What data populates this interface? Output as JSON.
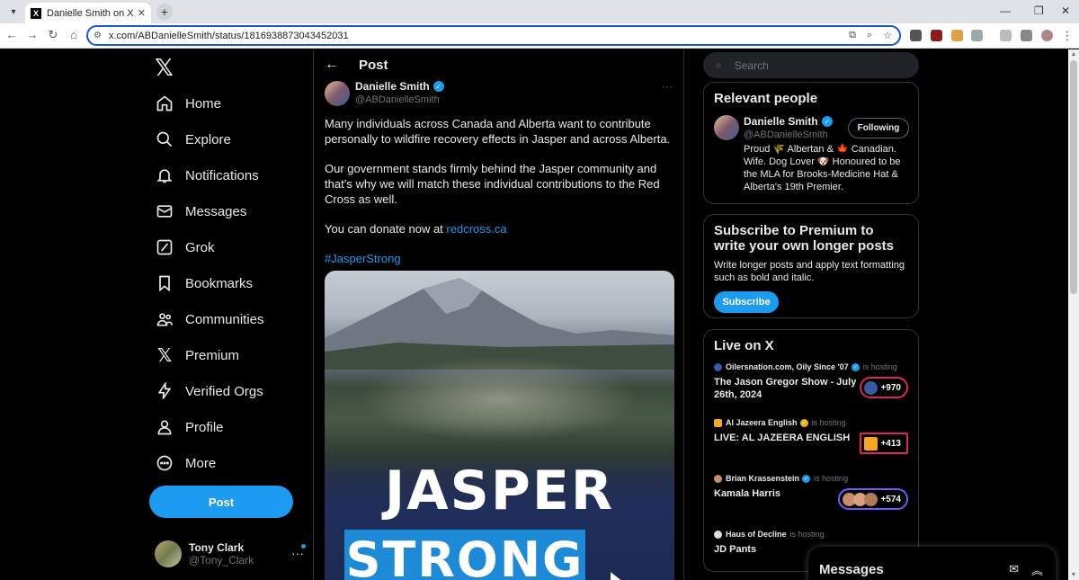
{
  "browser": {
    "tab_title": "Danielle Smith on X: \"Many indi",
    "url": "x.com/ABDanielleSmith/status/1816938873043452031"
  },
  "nav": {
    "items": [
      {
        "label": "Home",
        "icon": "home-icon"
      },
      {
        "label": "Explore",
        "icon": "search-icon"
      },
      {
        "label": "Notifications",
        "icon": "bell-icon"
      },
      {
        "label": "Messages",
        "icon": "envelope-icon"
      },
      {
        "label": "Grok",
        "icon": "grok-icon"
      },
      {
        "label": "Bookmarks",
        "icon": "bookmark-icon"
      },
      {
        "label": "Communities",
        "icon": "people-icon"
      },
      {
        "label": "Premium",
        "icon": "x-logo-icon"
      },
      {
        "label": "Verified Orgs",
        "icon": "lightning-icon"
      },
      {
        "label": "Profile",
        "icon": "person-icon"
      },
      {
        "label": "More",
        "icon": "more-circle-icon"
      }
    ],
    "post_button": "Post"
  },
  "account": {
    "name": "Tony Clark",
    "handle": "@Tony_Clark"
  },
  "post": {
    "header_title": "Post",
    "author_name": "Danielle Smith",
    "author_handle": "@ABDanielleSmith",
    "paragraph1": "Many individuals across Canada and Alberta want to contribute personally to wildfire recovery effects in Jasper and across Alberta.",
    "paragraph2": "Our government stands firmly behind the Jasper community and that’s why we will match these individual contributions to the Red Cross as well.",
    "paragraph3_prefix": "You can donate now at ",
    "paragraph3_link": "redcross.ca",
    "hashtag": "#JasperStrong",
    "image_line1": "JASPER",
    "image_line2": "STRONG"
  },
  "search": {
    "placeholder": "Search"
  },
  "relevant": {
    "title": "Relevant people",
    "name": "Danielle Smith",
    "handle": "@ABDanielleSmith",
    "follow_label": "Following",
    "bio": "Proud 🌾 Albertan & 🍁 Canadian. Wife. Dog Lover 🐶 Honoured to be the MLA for Brooks-Medicine Hat & Alberta's 19th Premier."
  },
  "premium": {
    "title": "Subscribe to Premium to write your own longer posts",
    "text": "Write longer posts and apply text formatting such as bold and italic.",
    "button": "Subscribe"
  },
  "live": {
    "title": "Live on X",
    "hosting_label": "is hosting",
    "items": [
      {
        "host": "Oilersnation.com, Oily Since '07",
        "title": "The Jason Gregor Show - July 26th, 2024",
        "count": "+970",
        "host_color": "#3b5ba0",
        "badge_color": "#1d9bf0"
      },
      {
        "host": "Al Jazeera English",
        "title": "LIVE: AL JAZEERA ENGLISH",
        "count": "+413",
        "host_color": "#f5a623",
        "badge_color": "#e8b21a"
      },
      {
        "host": "Brian Krassenstein",
        "title": "Kamala Harris",
        "count": "+574",
        "host_color": "#c98b6b",
        "badge_color": "#1d9bf0"
      },
      {
        "host": "Haus of Decline",
        "title": "JD Pants",
        "count": "",
        "host_color": "#dddddd",
        "badge_color": ""
      }
    ]
  },
  "messages": {
    "title": "Messages"
  },
  "colors": {
    "accent": "#1d9bf0",
    "live_border": "#e0245e"
  }
}
